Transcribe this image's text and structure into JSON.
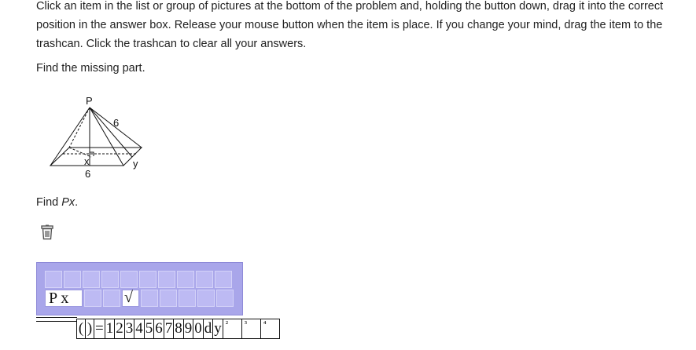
{
  "instructions": "Click an item in the list or group of pictures at the bottom of the problem and, holding the button down, drag it into the correct position in the answer box. Release your mouse button when the item is place. If you change your mind, drag the item to the trashcan. Click the trashcan to clear all your answers.",
  "prompt": "Find the missing part.",
  "figure": {
    "apex_label": "P",
    "slant_label": "6",
    "x_label": "x",
    "base_label": "6",
    "y_label": "y"
  },
  "question": {
    "prefix": "Find ",
    "target": "Px",
    "suffix": "."
  },
  "trash": {
    "icon": "trashcan-icon"
  },
  "answer_box": {
    "entered": "P x",
    "sqrt_symbol": "√"
  },
  "palette": {
    "items": [
      "(",
      ")",
      "=",
      "1",
      "2",
      "3",
      "4",
      "5",
      "6",
      "7",
      "8",
      "9",
      "0",
      "d",
      "y",
      "²",
      "³",
      "⁴"
    ]
  },
  "colors": {
    "answer_box_bg": "#a9a6ea",
    "cell_bg": "#bdbaf3"
  }
}
